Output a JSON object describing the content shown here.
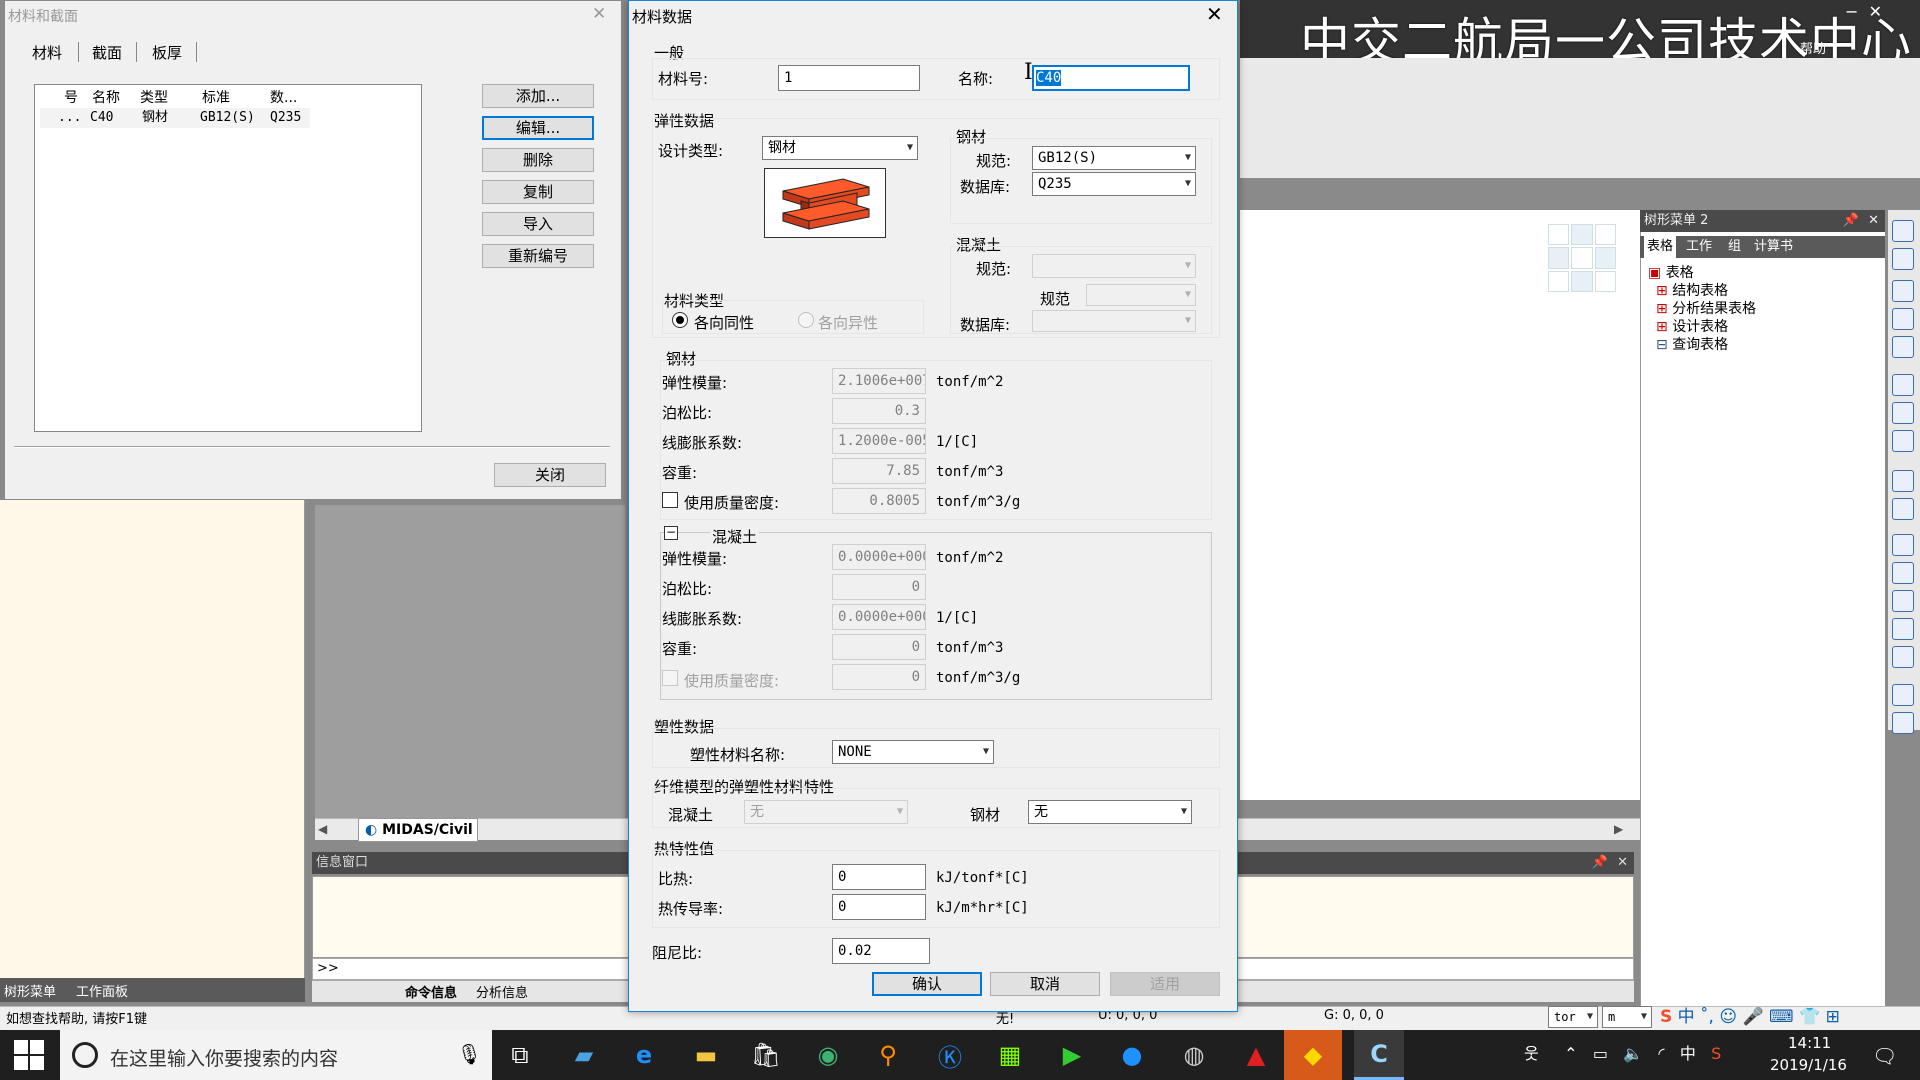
{
  "banner": {
    "title": "中交二航局一公司技术中心",
    "help": "帮助"
  },
  "mat_section": {
    "title": "材料和截面",
    "tabs": [
      "材料",
      "截面",
      "板厚"
    ],
    "columns": [
      "号",
      "名称",
      "类型",
      "标准",
      "数..."
    ],
    "rows": [
      {
        "no": "...",
        "name": "C40",
        "type": "钢材",
        "std": "GB12(S)",
        "db": "Q235"
      }
    ],
    "buttons": {
      "add": "添加...",
      "edit": "编辑...",
      "delete": "删除",
      "copy": "复制",
      "import": "导入",
      "renumber": "重新编号",
      "close": "关闭"
    }
  },
  "dialog": {
    "title": "材料数据",
    "general": {
      "section": "一般",
      "matno_label": "材料号:",
      "matno_value": "1",
      "name_label": "名称:",
      "name_value": "C40"
    },
    "elastic": {
      "section": "弹性数据",
      "design_type_label": "设计类型:",
      "design_type_value": "钢材",
      "steel_group": "钢材",
      "std_label": "规范:",
      "std_value": "GB12(S)",
      "db_label": "数据库:",
      "db_value": "Q235",
      "concrete_group": "混凝土",
      "c_std_label": "规范:",
      "c_std2_label": "规范",
      "c_db_label": "数据库:"
    },
    "mat_type": {
      "label": "材料类型",
      "iso": "各向同性",
      "aniso": "各向异性"
    },
    "steel": {
      "section": "钢材",
      "e_label": "弹性模量:",
      "e_value": "2.1006e+007",
      "e_unit": "tonf/m^2",
      "nu_label": "泊松比:",
      "nu_value": "0.3",
      "alpha_label": "线膨胀系数:",
      "alpha_value": "1.2000e-005",
      "alpha_unit": "1/[C]",
      "w_label": "容重:",
      "w_value": "7.85",
      "w_unit": "tonf/m^3",
      "md_label": "使用质量密度:",
      "md_value": "0.8005",
      "md_unit": "tonf/m^3/g"
    },
    "concrete": {
      "section": "混凝土",
      "e_label": "弹性模量:",
      "e_value": "0.0000e+000",
      "e_unit": "tonf/m^2",
      "nu_label": "泊松比:",
      "nu_value": "0",
      "alpha_label": "线膨胀系数:",
      "alpha_value": "0.0000e+000",
      "alpha_unit": "1/[C]",
      "w_label": "容重:",
      "w_value": "0",
      "w_unit": "tonf/m^3",
      "md_label": "使用质量密度:",
      "md_value": "0",
      "md_unit": "tonf/m^3/g"
    },
    "plastic": {
      "section": "塑性数据",
      "name_label": "塑性材料名称:",
      "name_value": "NONE"
    },
    "fiber": {
      "section": "纤维模型的弹塑性材料特性",
      "concrete_label": "混凝土",
      "concrete_value": "无",
      "steel_label": "钢材",
      "steel_value": "无"
    },
    "thermal": {
      "section": "热特性值",
      "sh_label": "比热:",
      "sh_value": "0",
      "sh_unit": "kJ/tonf*[C]",
      "tc_label": "热传导率:",
      "tc_value": "0",
      "tc_unit": "kJ/m*hr*[C]"
    },
    "damping": {
      "label": "阻尼比:",
      "value": "0.02"
    },
    "buttons": {
      "ok": "确认",
      "cancel": "取消",
      "apply": "适用"
    }
  },
  "tree_panel": {
    "title": "树形菜单 2",
    "tabs": [
      "表格",
      "工作",
      "组",
      "计算书"
    ],
    "items": [
      "表格",
      "结构表格",
      "分析结果表格",
      "设计表格",
      "查询表格"
    ]
  },
  "midas_tab": "MIDAS/Civil",
  "info_window": {
    "title": "信息窗口",
    "prompt": ">>",
    "tabs": [
      "命令信息",
      "分析信息"
    ]
  },
  "left_tabs": [
    "树形菜单",
    "工作面板"
  ],
  "status": {
    "help": "如想查找帮助, 请按F1键",
    "none": "无!",
    "u": "U: 0, 0, 0",
    "g": "G: 0, 0, 0",
    "force_unit": "tor",
    "len_unit": "m"
  },
  "taskbar": {
    "search_placeholder": "在这里输入你要搜索的内容",
    "time": "14:11",
    "date": "2019/1/16",
    "ime": "中"
  }
}
